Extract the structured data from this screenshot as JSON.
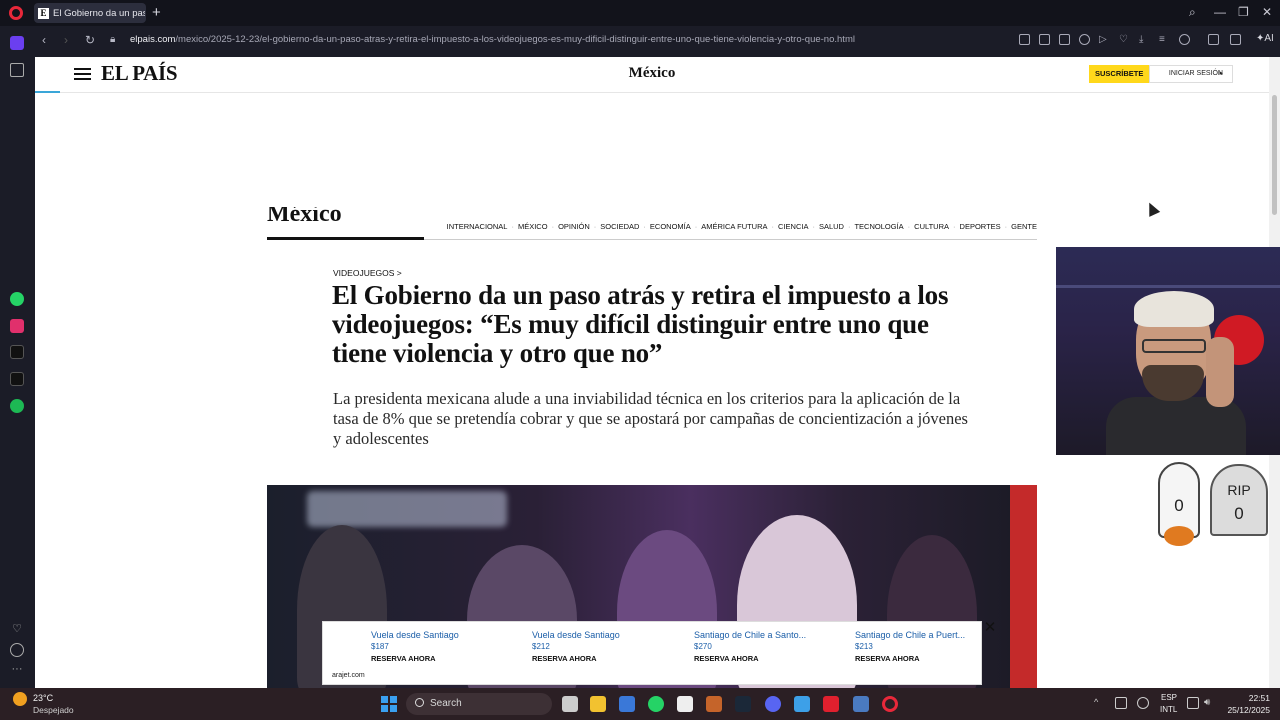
{
  "browser": {
    "tab_title": "El Gobierno da un paso atrás",
    "tab_favicon": "E",
    "url_host": "elpais.com",
    "url_path": "/mexico/2025-12-23/el-gobierno-da-un-paso-atras-y-retira-el-impuesto-a-los-videojuegos-es-muy-dificil-distinguir-entre-uno-que-tiene-violencia-y-otro-que-no.html",
    "ai_label": "AI"
  },
  "site": {
    "logo": "EL PAÍS",
    "edition": "México",
    "subscribe_label": "SUSCRÍBETE",
    "login_label": "INICIAR SESIÓN",
    "section_name": "México",
    "nav": [
      "INTERNACIONAL",
      "MÉXICO",
      "OPINIÓN",
      "SOCIEDAD",
      "ECONOMÍA",
      "AMÉRICA FUTURA",
      "CIENCIA",
      "SALUD",
      "TECNOLOGÍA",
      "CULTURA",
      "DEPORTES",
      "GENTE"
    ]
  },
  "article": {
    "kicker": "VIDEOJUEGOS >",
    "headline": "El Gobierno da un paso atrás y retira el impuesto a los videojuegos: “Es muy difícil distinguir entre uno que tiene violencia y otro que no”",
    "subhead": "La presidenta mexicana alude a una inviabilidad técnica en los criterios para la aplicación de la tasa de 8% que se pretendía cobrar y que se apostará por campañas de concientización a jóvenes y adolescentes"
  },
  "ad": {
    "items": [
      {
        "title": "Vuela desde Santiago",
        "price": "$187",
        "cta": "RESERVA AHORA"
      },
      {
        "title": "Vuela desde Santiago",
        "price": "$212",
        "cta": "RESERVA AHORA"
      },
      {
        "title": "Santiago de Chile a Santo...",
        "price": "$270",
        "cta": "RESERVA AHORA"
      },
      {
        "title": "Santiago de Chile a Puert...",
        "price": "$213",
        "cta": "RESERVA AHORA"
      }
    ],
    "source": "arajet.com"
  },
  "overlay": {
    "ghost_count": "0",
    "tomb_label": "RIP",
    "tomb_count": "0"
  },
  "taskbar": {
    "weather_temp": "23°C",
    "weather_desc": "Despejado",
    "search_label": "Search",
    "lang_1": "ESP",
    "lang_2": "INTL",
    "time": "22:51",
    "date": "25/12/2025"
  },
  "colors": {
    "subscribe_bg": "#ffd81b",
    "opera_red": "#e8283a",
    "link_blue": "#1b5ea8"
  }
}
